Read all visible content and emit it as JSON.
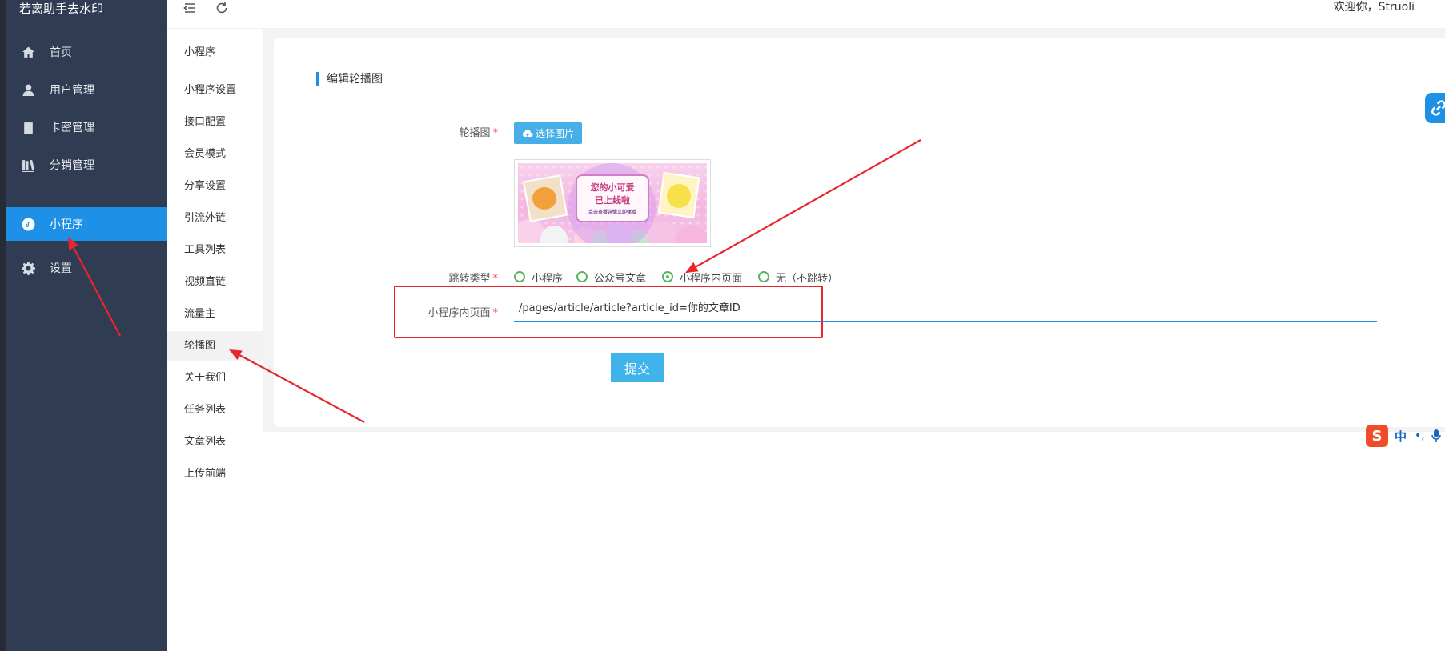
{
  "app": {
    "brand": "若离助手去水印"
  },
  "sidebar": {
    "items": [
      {
        "label": "首页",
        "icon": "home-icon"
      },
      {
        "label": "用户管理",
        "icon": "user-icon"
      },
      {
        "label": "卡密管理",
        "icon": "clipboard-icon"
      },
      {
        "label": "分销管理",
        "icon": "books-icon"
      },
      {
        "label": "小程序",
        "icon": "miniprogram-icon",
        "active": true
      },
      {
        "label": "设置",
        "icon": "gear-icon"
      }
    ],
    "active_color": "#1e90e6"
  },
  "header": {
    "welcome": "欢迎你，Struoli"
  },
  "submenu": {
    "title": "小程序",
    "items": [
      {
        "label": "小程序设置"
      },
      {
        "label": "接口配置"
      },
      {
        "label": "会员模式"
      },
      {
        "label": "分享设置"
      },
      {
        "label": "引流外链"
      },
      {
        "label": "工具列表"
      },
      {
        "label": "视频直链"
      },
      {
        "label": "流量主"
      },
      {
        "label": "轮播图",
        "active": true
      },
      {
        "label": "关于我们"
      },
      {
        "label": "任务列表"
      },
      {
        "label": "文章列表"
      },
      {
        "label": "上传前端"
      }
    ]
  },
  "form": {
    "title": "编辑轮播图",
    "banner_label": "轮播图",
    "choose_image": "选择图片",
    "banner_image": {
      "line1": "您的小可爱",
      "line2": "已上线啦",
      "line3": "点击查看详情立即体验"
    },
    "jump_type_label": "跳转类型",
    "jump_options": [
      {
        "label": "小程序",
        "checked": false
      },
      {
        "label": "公众号文章",
        "checked": false
      },
      {
        "label": "小程序内页面",
        "checked": true
      },
      {
        "label": "无（不跳转）",
        "checked": false
      }
    ],
    "page_label": "小程序内页面",
    "page_value": "/pages/article/article?article_id=你的文章ID",
    "required_mark": "*",
    "submit": "提交"
  },
  "ime": {
    "logo": "S",
    "mode": "中",
    "punct": "•,"
  }
}
